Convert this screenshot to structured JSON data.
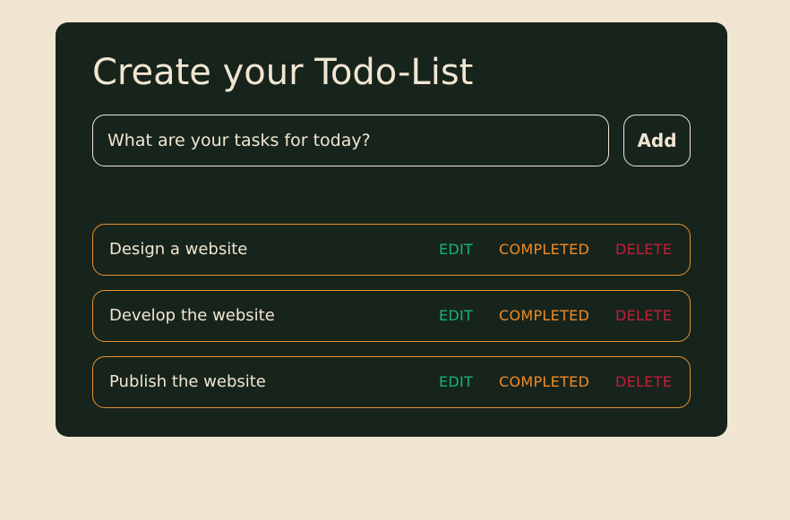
{
  "app": {
    "title": "Create your Todo-List"
  },
  "form": {
    "input_placeholder": "What are your tasks for today?",
    "input_value": "",
    "add_label": "Add"
  },
  "actions": {
    "edit_label": "EDIT",
    "completed_label": "COMPLETED",
    "delete_label": "DELETE"
  },
  "todos": [
    {
      "text": "Design a website"
    },
    {
      "text": "Develop the website"
    },
    {
      "text": "Publish the website"
    }
  ],
  "colors": {
    "page_background": "#f1e6d2",
    "card_background": "#17241c",
    "text": "#f1e6d2",
    "item_border": "#e8922e",
    "edit": "#16b37a",
    "completed": "#f08a26",
    "delete": "#c41e3a"
  }
}
